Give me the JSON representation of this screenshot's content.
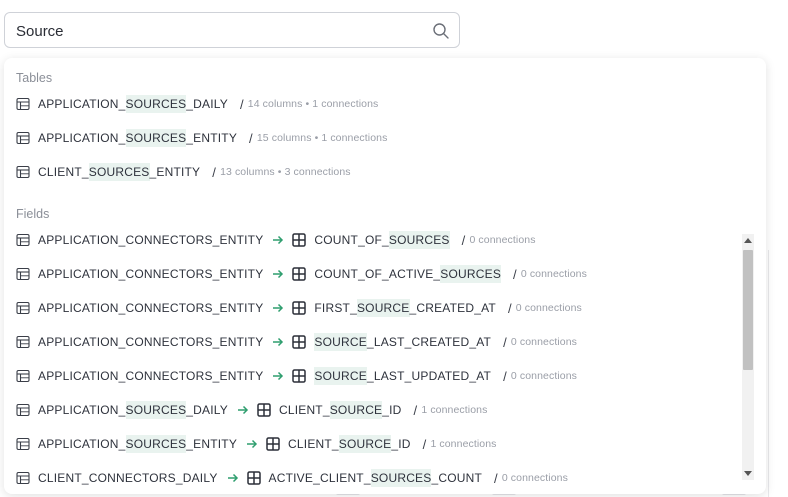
{
  "search": {
    "value": "Source",
    "placeholder": "Search"
  },
  "tables_section": {
    "title": "Tables",
    "items": [
      {
        "pre": "APPLICATION_",
        "match": "SOURCES",
        "post": "_DAILY",
        "meta": "14 columns • 1 connections"
      },
      {
        "pre": "APPLICATION_",
        "match": "SOURCES",
        "post": "_ENTITY",
        "meta": "15 columns • 1 connections"
      },
      {
        "pre": "CLIENT_",
        "match": "SOURCES",
        "post": "_ENTITY",
        "meta": "13 columns • 3 connections"
      }
    ]
  },
  "fields_section": {
    "title": "Fields",
    "items": [
      {
        "table": "APPLICATION_CONNECTORS_ENTITY",
        "f_pre": "COUNT_OF_",
        "f_match": "SOURCES",
        "f_post": "",
        "meta": "0 connections"
      },
      {
        "table": "APPLICATION_CONNECTORS_ENTITY",
        "f_pre": "COUNT_OF_ACTIVE_",
        "f_match": "SOURCES",
        "f_post": "",
        "meta": "0 connections"
      },
      {
        "table": "APPLICATION_CONNECTORS_ENTITY",
        "f_pre": "FIRST_",
        "f_match": "SOURCE",
        "f_post": "_CREATED_AT",
        "meta": "0 connections"
      },
      {
        "table": "APPLICATION_CONNECTORS_ENTITY",
        "f_pre": "",
        "f_match": "SOURCE",
        "f_post": "_LAST_CREATED_AT",
        "meta": "0 connections"
      },
      {
        "table": "APPLICATION_CONNECTORS_ENTITY",
        "f_pre": "",
        "f_match": "SOURCE",
        "f_post": "_LAST_UPDATED_AT",
        "meta": "0 connections"
      },
      {
        "t_pre": "APPLICATION_",
        "t_match": "SOURCES",
        "t_post": "_DAILY",
        "f_pre": "CLIENT_",
        "f_match": "SOURCE",
        "f_post": "_ID",
        "meta": "1 connections"
      },
      {
        "t_pre": "APPLICATION_",
        "t_match": "SOURCES",
        "t_post": "_ENTITY",
        "f_pre": "CLIENT_",
        "f_match": "SOURCE",
        "f_post": "_ID",
        "meta": "1 connections"
      },
      {
        "table": "CLIENT_CONNECTORS_DAILY",
        "f_pre": "ACTIVE_CLIENT_",
        "f_match": "SOURCES",
        "f_post": "_COUNT",
        "meta": "0 connections"
      }
    ]
  },
  "separator": "/",
  "colors": {
    "highlight": "#e9f3ef",
    "arrow": "#2e9e6e",
    "border": "#cfd2d8"
  },
  "icons": {
    "search": "search-icon",
    "table": "table-icon",
    "field": "grid-icon",
    "arrow": "arrow-right-icon"
  }
}
